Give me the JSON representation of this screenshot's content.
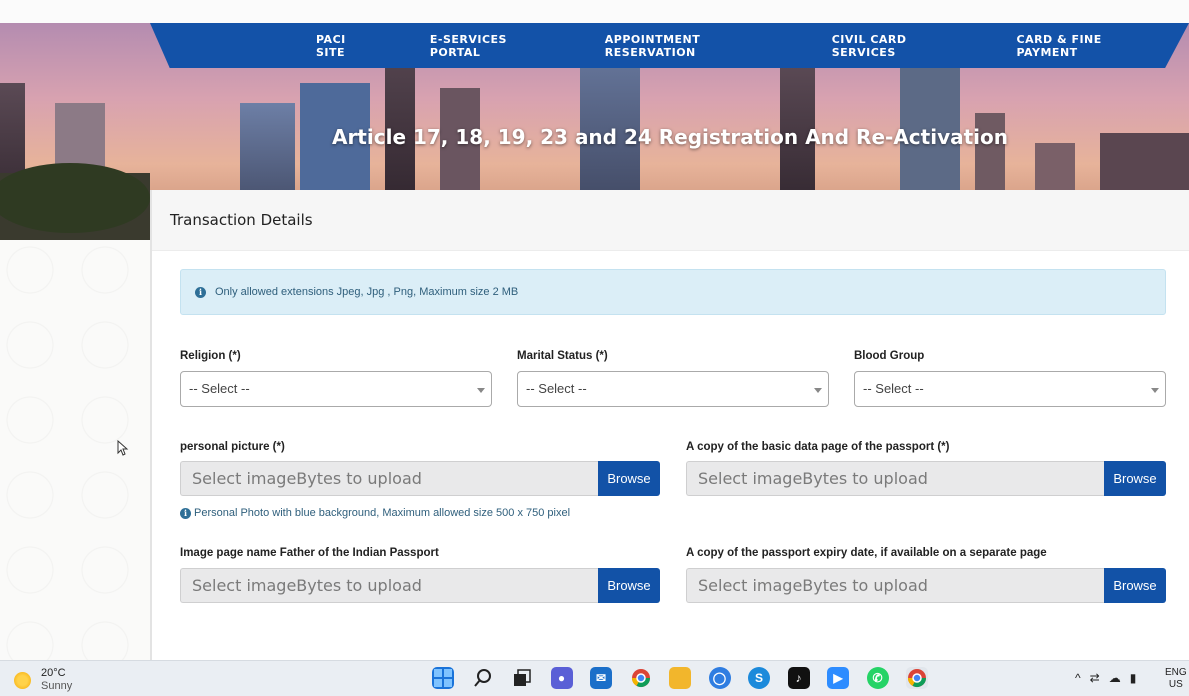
{
  "nav": {
    "items": [
      "PACI SITE",
      "E-SERVICES PORTAL",
      "APPOINTMENT RESERVATION",
      "CIVIL CARD SERVICES",
      "CARD & FINE PAYMENT"
    ]
  },
  "hero": {
    "title": "Article 17, 18, 19, 23 and 24 Registration And Re-Activation"
  },
  "card": {
    "title": "Transaction Details",
    "alert": "Only allowed extensions Jpeg, Jpg , Png, Maximum size 2 MB",
    "selects": [
      {
        "label": "Religion (*)",
        "value": "-- Select --"
      },
      {
        "label": "Marital Status (*)",
        "value": "-- Select --"
      },
      {
        "label": "Blood Group",
        "value": "-- Select --"
      }
    ],
    "uploads": [
      {
        "label": "personal picture (*)",
        "placeholder": "Select imageBytes to upload",
        "button": "Browse"
      },
      {
        "label": "A copy of the basic data page of the passport (*)",
        "placeholder": "Select imageBytes to upload",
        "button": "Browse"
      },
      {
        "label": "Image page name Father of the Indian Passport",
        "placeholder": "Select imageBytes to upload",
        "button": "Browse"
      },
      {
        "label": "A copy of the passport expiry date, if available on a separate page",
        "placeholder": "Select imageBytes to upload",
        "button": "Browse"
      }
    ],
    "photo_helper": "Personal Photo with blue background, Maximum allowed size 500 x 750 pixel"
  },
  "taskbar": {
    "weather_temp": "20°C",
    "weather_cond": "Sunny",
    "lang_line1": "ENG",
    "lang_line2": "US"
  },
  "colors": {
    "nav_blue": "#1352a8",
    "browse_blue": "#1252a7",
    "alert_bg": "#dbeef7"
  }
}
